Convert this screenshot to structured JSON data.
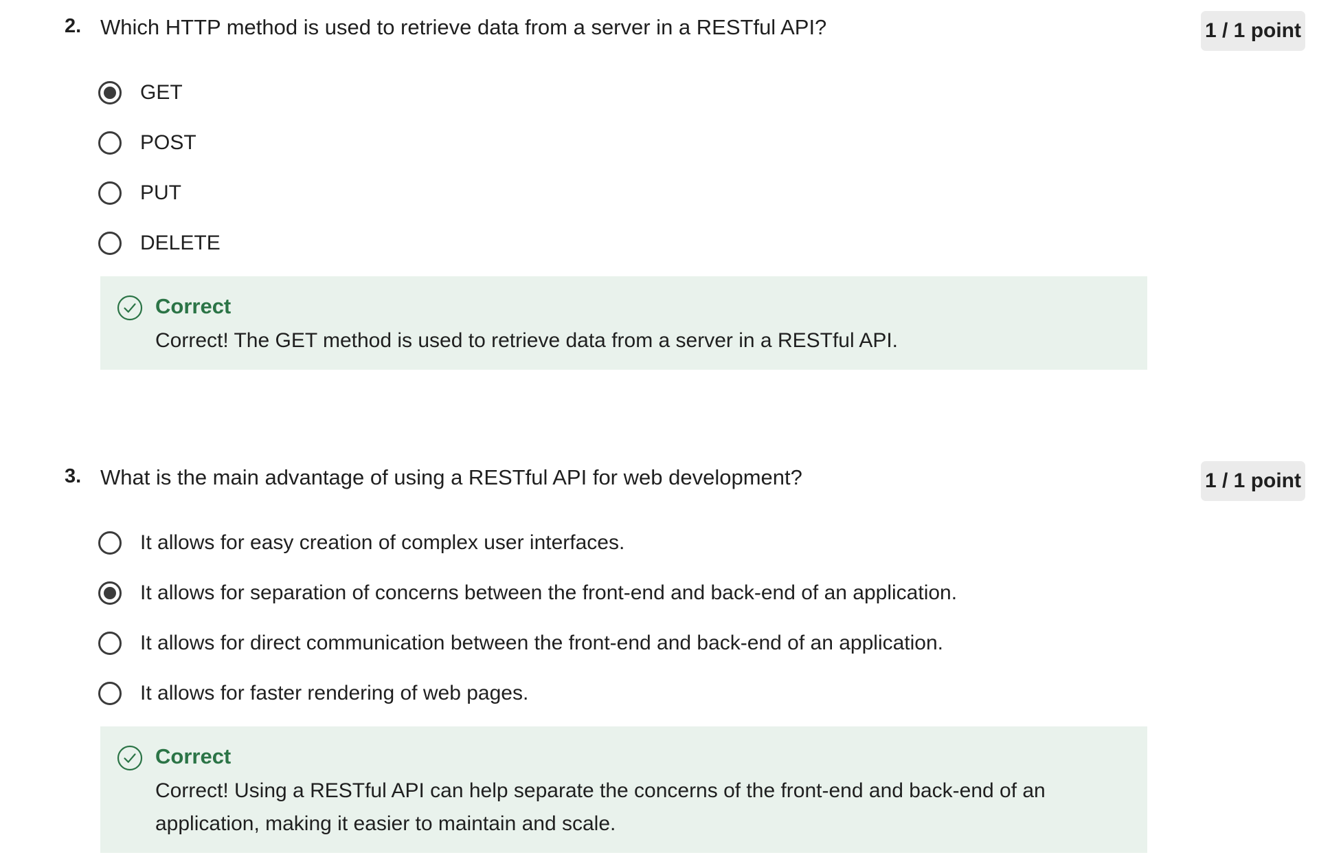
{
  "questions": [
    {
      "number": "2.",
      "text": "Which HTTP method is used to retrieve data from a server in a RESTful API?",
      "points": "1 / 1 point",
      "options": [
        {
          "label": "GET",
          "selected": true
        },
        {
          "label": "POST",
          "selected": false
        },
        {
          "label": "PUT",
          "selected": false
        },
        {
          "label": "DELETE",
          "selected": false
        }
      ],
      "feedback": {
        "title": "Correct",
        "text": "Correct! The GET method is used to retrieve data from a server in a RESTful API."
      }
    },
    {
      "number": "3.",
      "text": "What is the main advantage of using a RESTful API for web development?",
      "points": "1 / 1 point",
      "options": [
        {
          "label": "It allows for easy creation of complex user interfaces.",
          "selected": false
        },
        {
          "label": "It allows for separation of concerns between the front-end and back-end of an application.",
          "selected": true
        },
        {
          "label": "It allows for direct communication between the front-end and back-end of an application.",
          "selected": false
        },
        {
          "label": "It allows for faster rendering of web pages.",
          "selected": false
        }
      ],
      "feedback": {
        "title": "Correct",
        "text": "Correct! Using a RESTful API can help separate the concerns of the front-end and back-end of an application, making it easier to maintain and scale."
      }
    }
  ],
  "colors": {
    "correct_green": "#2b7446",
    "feedback_bg": "#e9f2ec",
    "points_bg": "#ebebeb",
    "radio": "#3b3b3b"
  },
  "icons": {
    "feedback": "check-circle-icon",
    "option_selected": "radio-selected",
    "option_unselected": "radio-unselected"
  }
}
